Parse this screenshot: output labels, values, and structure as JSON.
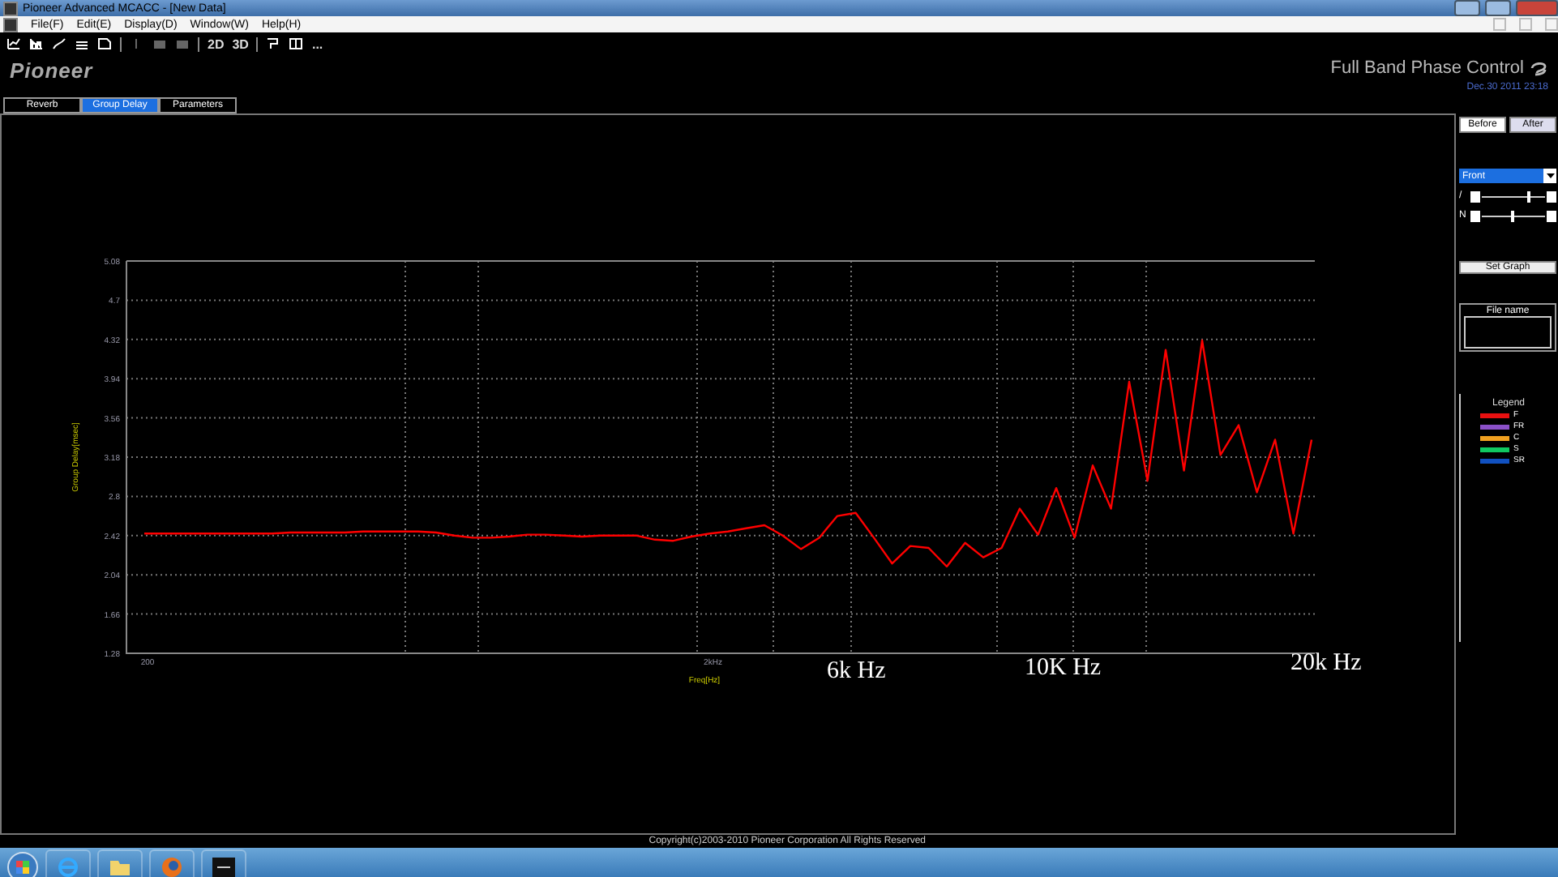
{
  "window": {
    "title": "Pioneer Advanced MCACC - [New Data]"
  },
  "menu": [
    "File(F)",
    "Edit(E)",
    "Display(D)",
    "Window(W)",
    "Help(H)"
  ],
  "toolbar": {
    "view_buttons": [
      "2D",
      "3D"
    ],
    "more": "..."
  },
  "header": {
    "logo": "Pioneer",
    "product": "Full Band Phase Control",
    "date": "Dec.30 2011 23:18"
  },
  "tabs": [
    {
      "label": "Reverb",
      "selected": false
    },
    {
      "label": "Group Delay",
      "selected": true
    },
    {
      "label": "Parameters",
      "selected": false
    }
  ],
  "chart": {
    "chart_data": {
      "type": "line",
      "xlabel": "Freq[Hz]",
      "ylabel": "Group Delay[msec]",
      "categories": [
        "200",
        null,
        null,
        null,
        null,
        null,
        null,
        null,
        null,
        null,
        null,
        null,
        null,
        null,
        null,
        null,
        null,
        null,
        null,
        null,
        null,
        null,
        null,
        null,
        null,
        null,
        null,
        null,
        null,
        null,
        null,
        "2kHz",
        null,
        null,
        null,
        null,
        null,
        null,
        null,
        null,
        null,
        null,
        null,
        null,
        null,
        null,
        null,
        null,
        null,
        null,
        null,
        null,
        null,
        null,
        null,
        null,
        null,
        null,
        null,
        null,
        null,
        null,
        null,
        null,
        null
      ],
      "series": [
        {
          "color": "#ff0000",
          "values": [
            2.44,
            2.44,
            2.44,
            2.44,
            2.44,
            2.44,
            2.44,
            2.44,
            2.45,
            2.45,
            2.45,
            2.45,
            2.46,
            2.46,
            2.46,
            2.46,
            2.45,
            2.42,
            2.4,
            2.4,
            2.41,
            2.43,
            2.43,
            2.42,
            2.41,
            2.42,
            2.42,
            2.42,
            2.38,
            2.37,
            2.41,
            2.44,
            2.46,
            2.49,
            2.52,
            2.42,
            2.29,
            2.4,
            2.61,
            2.64,
            2.4,
            2.15,
            2.32,
            2.3,
            2.12,
            2.35,
            2.21,
            2.3,
            2.68,
            2.43,
            2.88,
            2.4,
            3.1,
            2.68,
            3.91,
            2.95,
            4.22,
            3.05,
            4.31,
            3.2,
            3.49,
            2.84,
            3.35,
            2.44,
            3.35
          ]
        }
      ],
      "ylim": [
        1.28,
        5.08
      ],
      "grid": true,
      "yticks": [
        {
          "value": 5.08,
          "label": "5.08"
        },
        {
          "value": 4.7,
          "label": "4.7"
        },
        {
          "value": 4.32,
          "label": "4.32"
        },
        {
          "value": 3.94,
          "label": "3.94"
        },
        {
          "value": 3.56,
          "label": "3.56"
        },
        {
          "value": 3.18,
          "label": "3.18"
        },
        {
          "value": 2.8,
          "label": "2.8"
        },
        {
          "value": 2.42,
          "label": "2.42"
        },
        {
          "value": 2.04,
          "label": "2.04"
        },
        {
          "value": 1.66,
          "label": "1.66"
        },
        {
          "value": 1.28,
          "label": "1.28"
        }
      ]
    },
    "annotations": [
      "6k Hz",
      "10K Hz",
      "20k Hz"
    ]
  },
  "sidebar": {
    "before_after": [
      {
        "label": "Before",
        "selected": false
      },
      {
        "label": "After",
        "selected": true
      }
    ],
    "channel_select": {
      "value": "Front"
    },
    "sliders": [
      {
        "label": "/",
        "level": 0.72
      },
      {
        "label": "N",
        "level": 0.45
      }
    ],
    "set_graph": "Set Graph",
    "file_name": {
      "label": "File name"
    },
    "legend": {
      "title": "Legend",
      "items": [
        {
          "label": "F",
          "color": "#e81010"
        },
        {
          "label": "FR",
          "color": "#8a50c8"
        },
        {
          "label": "C",
          "color": "#f0a020"
        },
        {
          "label": "S",
          "color": "#10c860"
        },
        {
          "label": "SR",
          "color": "#1050c0"
        }
      ]
    }
  },
  "footer": {
    "copyright": "Copyright(c)2003-2010 Pioneer Corporation All Rights Reserved"
  }
}
